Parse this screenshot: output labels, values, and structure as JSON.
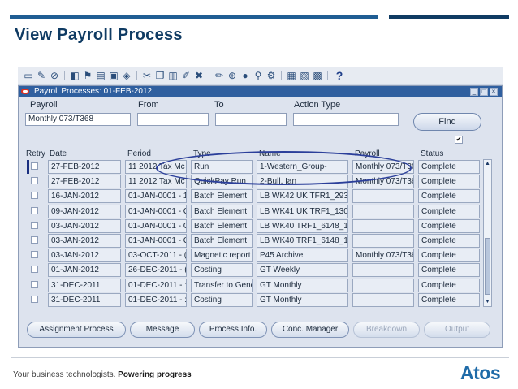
{
  "slide": {
    "title": "View Payroll Process",
    "footer_plain": "Your business technologists. ",
    "footer_bold": "Powering progress",
    "logo": "Atos",
    "accent_blue": "#1f5d93",
    "accent_dark": "#0f3b63"
  },
  "window": {
    "title": "Payroll Processes: 01-FEB-2012",
    "icon": "oracle-icon"
  },
  "toolbar": {
    "icons": [
      "open-icon",
      "flashlight-icon",
      "close-icon",
      "folder-icon",
      "flags-icon",
      "printer-icon",
      "save-icon",
      "lock-icon",
      "cut-icon",
      "copy-icon",
      "paste-icon",
      "edit-icon",
      "delete-icon",
      "translate-icon",
      "attach-icon",
      "zoom-icon",
      "clear-icon",
      "window-icon",
      "help-icon"
    ],
    "help_label": "?"
  },
  "search": {
    "payroll_label": "Payroll",
    "payroll_value": "Monthly 073/T368",
    "from_label": "From",
    "to_label": "To",
    "action_type_label": "Action Type",
    "find_label": "Find",
    "checked": "✔"
  },
  "table": {
    "headers": {
      "retry": "Retry",
      "date": "Date",
      "period": "Period",
      "type": "Type",
      "name": "Name",
      "payroll": "Payroll",
      "status": "Status"
    },
    "rows": [
      {
        "date": "27-FEB-2012",
        "period": "11 2012 Tax Mc",
        "type": "Run",
        "name": "1-Western_Group-",
        "payroll": "Monthly 073/T36",
        "status": "Complete"
      },
      {
        "date": "27-FEB-2012",
        "period": "11 2012 Tax Mc",
        "type": "QuickPay Run",
        "name": "2-Bull, Ian",
        "payroll": "Monthly 073/T36",
        "status": "Complete"
      },
      {
        "date": "16-JAN-2012",
        "period": "01-JAN-0001 - 1",
        "type": "Batch Element",
        "name": "LB WK42 UK TFR1_293",
        "payroll": "",
        "status": "Complete"
      },
      {
        "date": "09-JAN-2012",
        "period": "01-JAN-0001 - C",
        "type": "Batch Element",
        "name": "LB WK41 UK TRF1_130",
        "payroll": "",
        "status": "Complete"
      },
      {
        "date": "03-JAN-2012",
        "period": "01-JAN-0001 - C",
        "type": "Batch Element",
        "name": "LB WK40 TRF1_6148_1",
        "payroll": "",
        "status": "Complete"
      },
      {
        "date": "03-JAN-2012",
        "period": "01-JAN-0001 - C",
        "type": "Batch Element",
        "name": "LB WK40 TRF1_6148_1",
        "payroll": "",
        "status": "Complete"
      },
      {
        "date": "03-JAN-2012",
        "period": "03-OCT-2011 - (",
        "type": "Magnetic report",
        "name": "P45 Archive",
        "payroll": "Monthly 073/T36",
        "status": "Complete"
      },
      {
        "date": "01-JAN-2012",
        "period": "26-DEC-2011 - (",
        "type": "Costing",
        "name": "GT Weekly",
        "payroll": "",
        "status": "Complete"
      },
      {
        "date": "31-DEC-2011",
        "period": "01-DEC-2011 - :",
        "type": "Transfer to Gene",
        "name": "GT Monthly",
        "payroll": "",
        "status": "Complete"
      },
      {
        "date": "31-DEC-2011",
        "period": "01-DEC-2011 - :",
        "type": "Costing",
        "name": "GT Monthly",
        "payroll": "",
        "status": "Complete"
      }
    ]
  },
  "buttons": {
    "assignment_process": "Assignment Process",
    "message": "Message",
    "process_info": "Process Info.",
    "conc_manager": "Conc. Manager",
    "breakdown": "Breakdown",
    "output": "Output"
  }
}
